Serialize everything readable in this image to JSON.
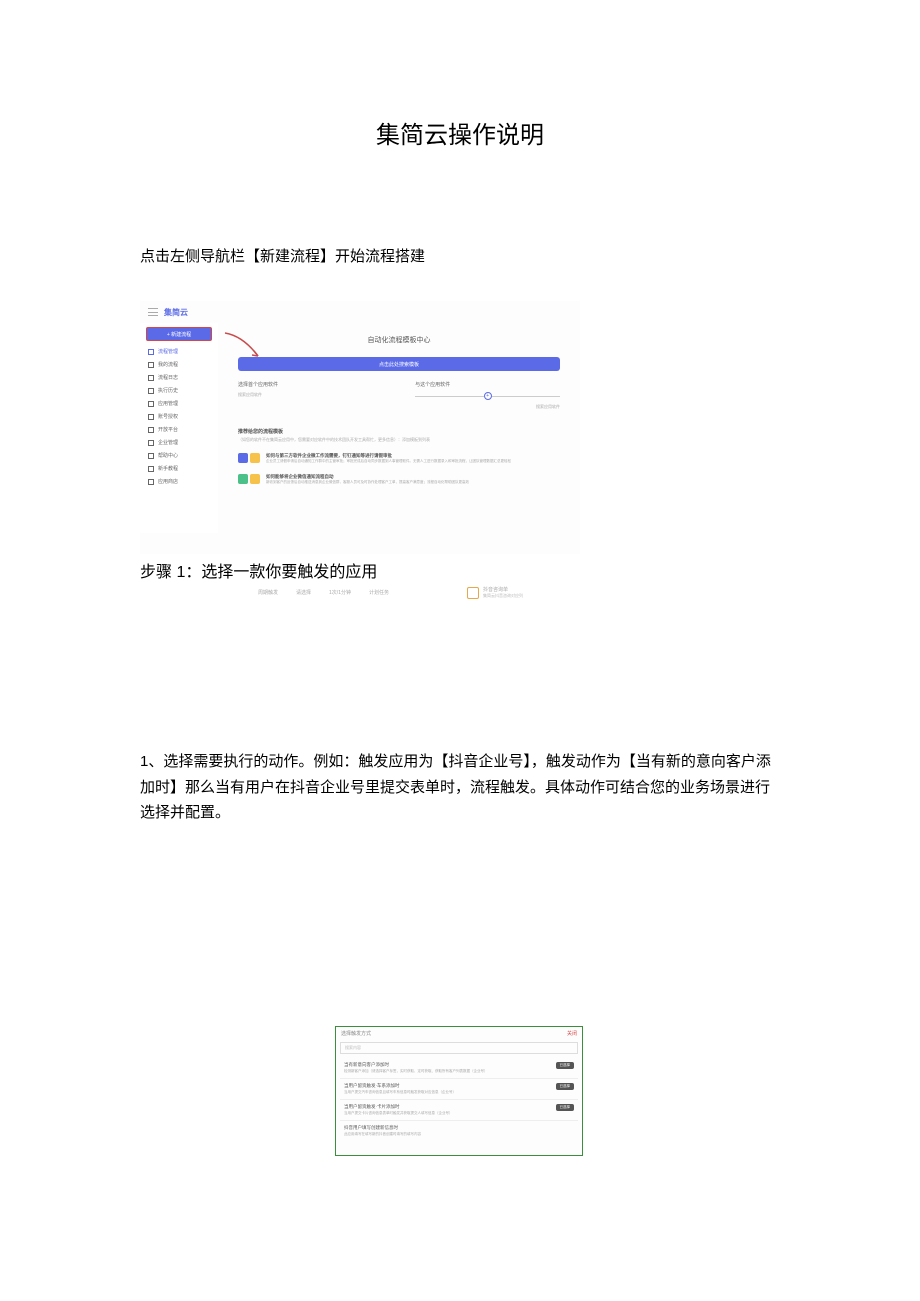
{
  "page_title": "集简云操作说明",
  "section_1_text": "点击左侧导航栏【新建流程】开始流程搭建",
  "screenshot1": {
    "logo": "集简云",
    "new_button": "+ 新建流程",
    "nav": [
      "流程管理",
      "我的流程",
      "流程日志",
      "执行历史",
      "应用管理",
      "账号授权",
      "开放平台",
      "企业管理",
      "帮助中心",
      "新手教程",
      "应用商店"
    ],
    "main_title": "自动化流程模板中心",
    "banner": "点击此处搜索模板",
    "flow_left_title": "选择首个应用软件",
    "flow_left_sub": "搜索应用软件",
    "flow_right_title": "与这个应用软件",
    "flow_right_sub": "搜索应用软件",
    "rec_title": "推荐给您的流程模板",
    "rec_sub": "（如您的软件不在集简云应用中，您需要对应软件中的技术团队开发工具帮忙，更多信息）：添加模板到列表",
    "card1_title": "如何与第三方软件企业微工作流需要，钉钉通知等进行请假审批",
    "card1_desc": "企业员工请假申请后自动通知工作群中的主管审批；审批完成后自动同步数据到人事管理软件。无需人工进行数据录入和审批流程，让团队管理数据汇总更轻松",
    "card2_title": "如何能够将企业微信通知流程自动",
    "card2_desc": "新收到客户的反馈后自动推送消息到企业微信群，客服人员可及时协作处理客户工单，提高客户满意度；流程自动化帮助团队更高效"
  },
  "step_1_label": "步骤 1：选择一款你要触发的应用",
  "step_1_footer": {
    "items": [
      "周期触发",
      "请选择",
      "1次/1分钟",
      "计划任务"
    ],
    "card_title": "抖音咨询单",
    "card_sub": "集简云抖音咨询对应列"
  },
  "body_text": "1、选择需要执行的动作。例如：触发应用为【抖音企业号】，触发动作为【当有新的意向客户添加时】那么当有用户在抖音企业号里提交表单时，流程触发。具体动作可结合您的业务场景进行选择并配置。",
  "screenshot2": {
    "header_left": "选择触发方式",
    "header_right": "关闭",
    "search_placeholder": "搜索内容",
    "items": [
      {
        "title": "当有新意向客户添加时",
        "desc": "检测新客户添加（请选择客户标签，实时获取、定时获取、获取所有客户列表数据（企业号）",
        "badge": "已选择"
      },
      {
        "title": "当用户留资触发·车系添加时",
        "desc": "当用户提交汽车咨询信息且填写车系信息时触发获取对应信息（企业号）",
        "badge": "已选择"
      },
      {
        "title": "当用户留资触发·卡片添加时",
        "desc": "当用户提交卡片咨询信息表单时触发并获取提交人填写信息（企业号）",
        "badge": "已选择"
      },
      {
        "title": "抖音用户填写创建新信息时",
        "desc": "此应用填写在填写新的抖音创建时填写的填写内容",
        "badge": ""
      }
    ]
  }
}
